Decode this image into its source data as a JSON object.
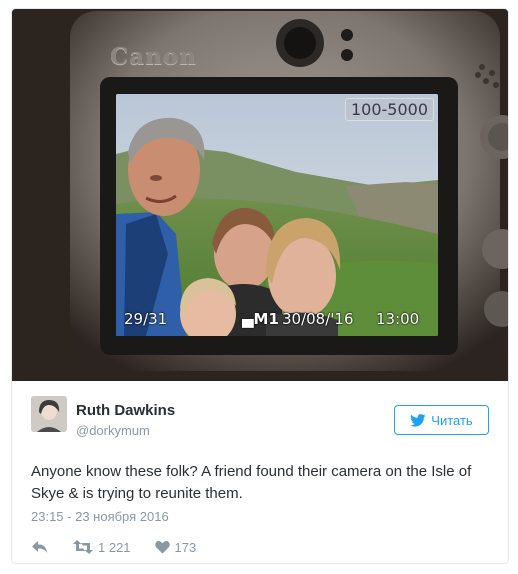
{
  "photo": {
    "camera_brand": "Canon",
    "lcd": {
      "iso": "100-5000",
      "frame_count": "29/31",
      "mode": "▄M1",
      "date": "30/08/'16",
      "time": "13:00"
    }
  },
  "tweet": {
    "author_name": "Ruth Dawkins",
    "author_handle": "@dorkymum",
    "follow_label": "Читать",
    "text": "Anyone know these folk? A friend found their camera on the Isle of Skye & is trying to reunite them.",
    "timestamp": "23:15 - 23 ноября 2016",
    "retweet_count": "1 221",
    "like_count": "173",
    "icons": {
      "follow": "twitter-bird-icon",
      "reply": "reply-icon",
      "retweet": "retweet-icon",
      "like": "heart-icon"
    }
  },
  "colors": {
    "accent": "#1da1f2",
    "text": "#292f33",
    "muted": "#8899a6",
    "border": "#e1e8ed"
  }
}
